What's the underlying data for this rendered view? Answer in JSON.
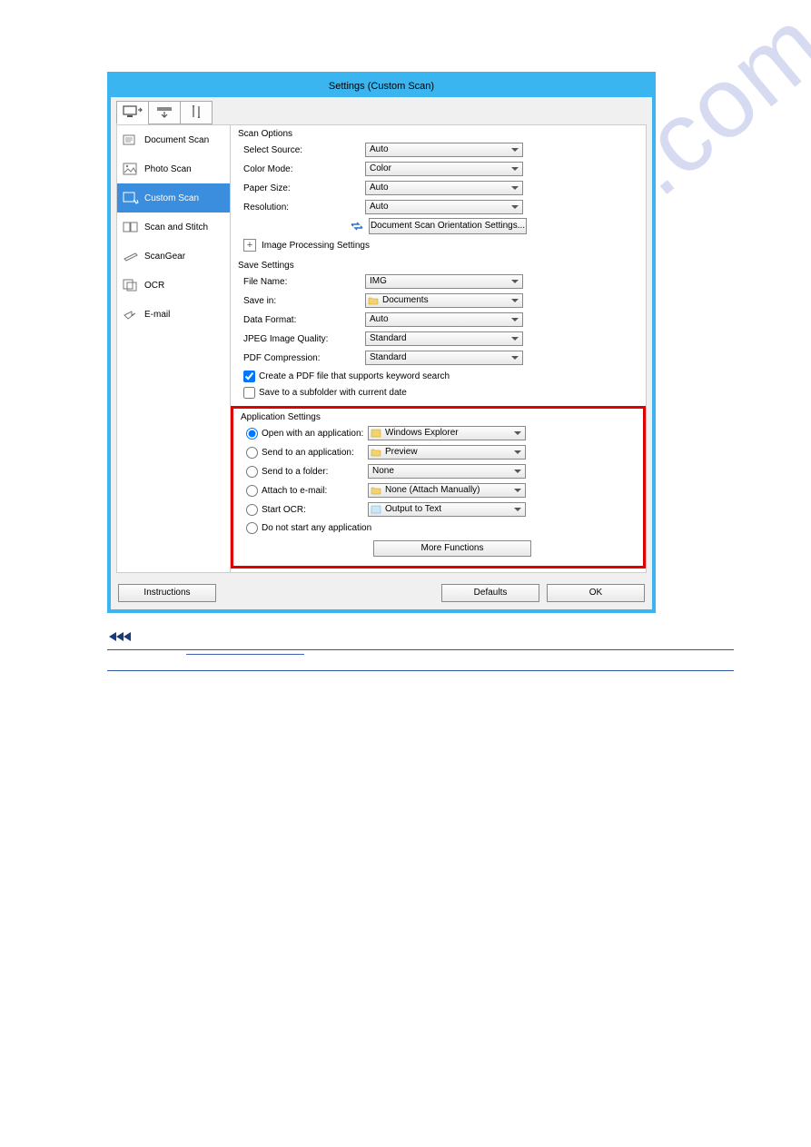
{
  "window": {
    "title": "Settings (Custom Scan)"
  },
  "sidebar": {
    "items": [
      {
        "label": "Document Scan"
      },
      {
        "label": "Photo Scan"
      },
      {
        "label": "Custom Scan"
      },
      {
        "label": "Scan and Stitch"
      },
      {
        "label": "ScanGear"
      },
      {
        "label": "OCR"
      },
      {
        "label": "E-mail"
      }
    ]
  },
  "scan_options": {
    "title": "Scan Options",
    "select_source": {
      "label": "Select Source:",
      "value": "Auto"
    },
    "color_mode": {
      "label": "Color Mode:",
      "value": "Color"
    },
    "paper_size": {
      "label": "Paper Size:",
      "value": "Auto"
    },
    "resolution": {
      "label": "Resolution:",
      "value": "Auto"
    },
    "orientation_btn": "Document Scan Orientation Settings...",
    "img_proc": "Image Processing Settings"
  },
  "save_settings": {
    "title": "Save Settings",
    "file_name": {
      "label": "File Name:",
      "value": "IMG"
    },
    "save_in": {
      "label": "Save in:",
      "value": "Documents"
    },
    "data_format": {
      "label": "Data Format:",
      "value": "Auto"
    },
    "jpeg": {
      "label": "JPEG Image Quality:",
      "value": "Standard"
    },
    "pdf": {
      "label": "PDF Compression:",
      "value": "Standard"
    },
    "chk_pdf": "Create a PDF file that supports keyword search",
    "chk_sub": "Save to a subfolder with current date"
  },
  "app_settings": {
    "title": "Application Settings",
    "open_app": {
      "label": "Open with an application:",
      "value": "Windows Explorer"
    },
    "send_app": {
      "label": "Send to an application:",
      "value": "Preview"
    },
    "send_folder": {
      "label": "Send to a folder:",
      "value": "None"
    },
    "attach": {
      "label": "Attach to e-mail:",
      "value": "None (Attach Manually)"
    },
    "ocr": {
      "label": "Start OCR:",
      "value": "Output to Text"
    },
    "no_start": "Do not start any application",
    "more": "More Functions"
  },
  "footer": {
    "instructions": "Instructions",
    "defaults": "Defaults",
    "ok": "OK"
  },
  "watermark": "manualshive.com"
}
